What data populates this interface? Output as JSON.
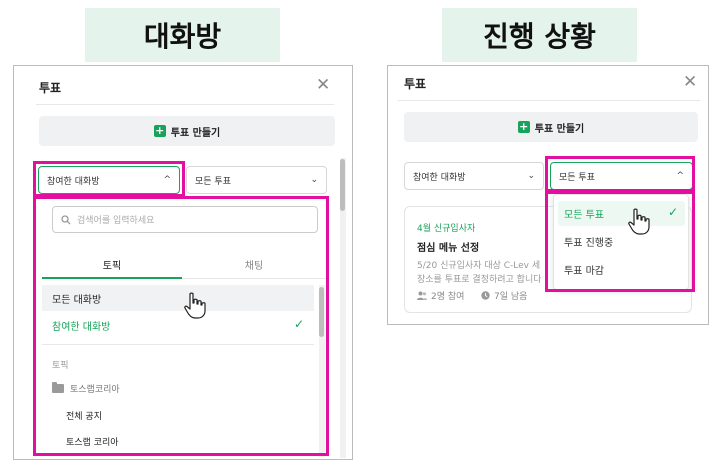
{
  "headings": {
    "left": "대화방",
    "right": "진행 상황"
  },
  "left_panel": {
    "title": "투표",
    "create_button": "투표 만들기",
    "filter_room": "참여한 대화방",
    "filter_status": "모든 투표",
    "search_placeholder": "검색어를 입력하세요",
    "tabs": [
      "토픽",
      "채팅"
    ],
    "items": {
      "all_rooms": "모든 대화방",
      "joined_rooms": "참여한 대화방",
      "section_topic": "토픽",
      "folder": "토스랩코리아",
      "topic_1": "전체 공지",
      "topic_2": "토스랩 코리아"
    }
  },
  "right_panel": {
    "title": "투표",
    "create_button": "투표 만들기",
    "filter_room": "참여한 대화방",
    "filter_status": "모든 투표",
    "card": {
      "tag": "4월 신규입사자",
      "title": "점심 메뉴 선정",
      "desc_1": "5/20 신규입사자 대상 C-Lev 세",
      "desc_2": "장소를 투표로 결정하려고 합니다",
      "participants": "2명 참여",
      "remaining": "7일 남음"
    },
    "menu": [
      "모든 투표",
      "투표 진행중",
      "투표 마감"
    ]
  },
  "colors": {
    "accent": "#17a35a",
    "highlight": "#e20fa0",
    "heading_bg": "#e4f4ec"
  }
}
